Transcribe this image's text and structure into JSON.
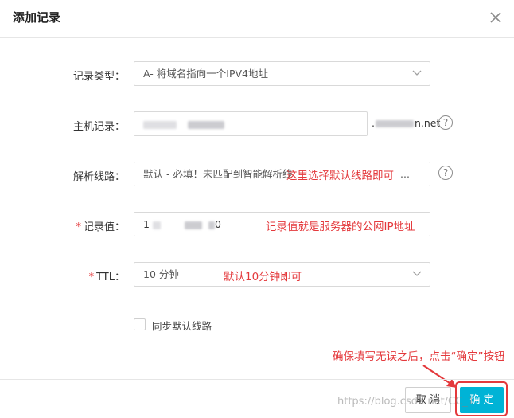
{
  "dialog": {
    "title": "添加记录",
    "close_icon": "close-icon"
  },
  "form": {
    "record_type": {
      "label": "记录类型：",
      "value": "A- 将域名指向一个IPV4地址"
    },
    "host_record": {
      "label": "主机记录：",
      "domain_suffix_start": ".",
      "domain_suffix_end": "n.net"
    },
    "resolve_line": {
      "label": "解析线路：",
      "value": "默认 - 必填！未匹配到智能解析线",
      "value_tail": "..."
    },
    "record_value": {
      "required_mark": "*",
      "label": "记录值：",
      "value_start": "1",
      "value_end": "0"
    },
    "ttl": {
      "required_mark": "*",
      "label": "TTL：",
      "value": "10 分钟"
    },
    "sync_default_line": {
      "label": "同步默认线路",
      "checked": false
    },
    "help_glyph": "?"
  },
  "annotations": {
    "resolve_line_note": "这里选择默认线路即可",
    "record_value_note": "记录值就是服务器的公网IP地址",
    "ttl_note": "默认10分钟即可",
    "confirm_note": "确保填写无误之后，点击“确定”按钮"
  },
  "footer": {
    "cancel_label": "取 消",
    "confirm_label": "确 定"
  },
  "watermark": "https://blog.csdn.net/CC_1",
  "colors": {
    "primary": "#00b3d6",
    "annotation_red": "#e4393c",
    "border": "#d9d9d9"
  }
}
